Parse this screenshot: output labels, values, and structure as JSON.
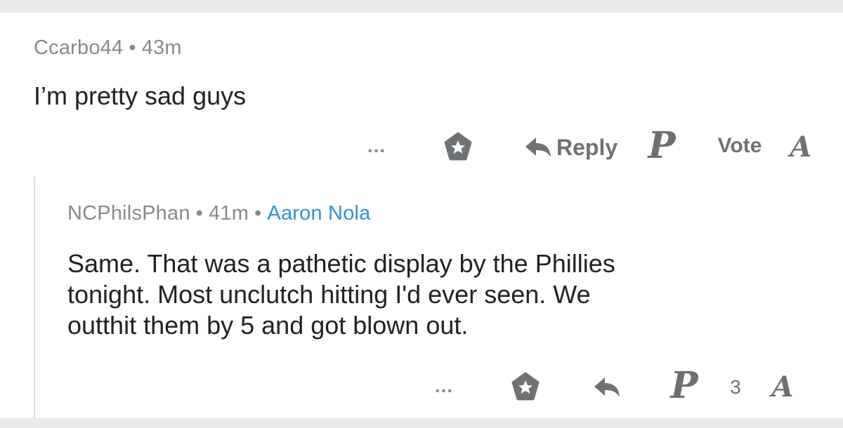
{
  "comments": [
    {
      "username": "Ccarbo44",
      "separator": "•",
      "time": "43m",
      "body": "I’m pretty sad guys",
      "actions": {
        "more": "...",
        "reply_label": "Reply",
        "vote_label": "Vote",
        "upvote_icon": "phillies-p-logo-icon",
        "downvote_icon": "braves-a-logo-icon"
      }
    },
    {
      "username": "NCPhilsPhan",
      "separator": "•",
      "time": "41m",
      "flair": "Aaron Nola",
      "body": "Same. That was a pathetic display by the Phillies\ntonight. Most unclutch hitting I'd ever seen. We\noutthit them by 5 and got blown out.",
      "actions": {
        "more": "...",
        "score": "3",
        "upvote_icon": "phillies-p-logo-icon",
        "downvote_icon": "braves-a-logo-icon"
      }
    }
  ],
  "colors": {
    "meta_gray": "#878a8c",
    "flair_blue": "#2f93d6",
    "icon_gray": "#6f7275",
    "background_band": "#ebebeb"
  }
}
